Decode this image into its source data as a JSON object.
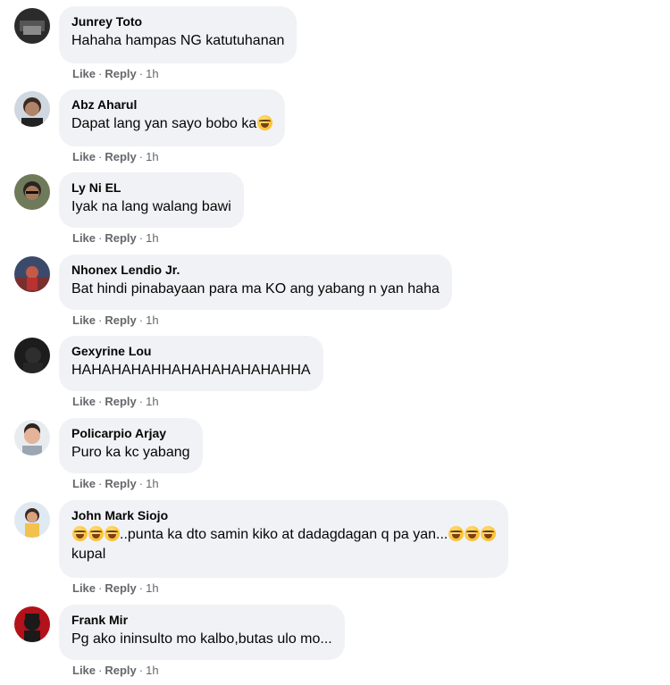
{
  "actions": {
    "like": "Like",
    "reply": "Reply",
    "separator": "·"
  },
  "comments": [
    {
      "author": "Junrey Toto",
      "text": "Hahaha hampas NG katutuhanan",
      "time": "1h"
    },
    {
      "author": "Abz Aharul",
      "text": "Dapat lang yan sayo bobo ka",
      "emoji": [
        "rolling-on-floor-laughing"
      ],
      "time": "1h"
    },
    {
      "author": "Ly Ni EL",
      "text": "Iyak na lang walang bawi",
      "time": "1h"
    },
    {
      "author": "Nhonex Lendio Jr.",
      "text": "Bat hindi pinabayaan para ma KO ang yabang n yan haha",
      "time": "1h"
    },
    {
      "author": "Gexyrine Lou",
      "text": "HAHAHAHAHHAHAHAHAHAHAHHA",
      "time": "1h"
    },
    {
      "author": "Policarpio Arjay",
      "text": "Puro ka kc yabang",
      "time": "1h"
    },
    {
      "author": "John Mark Siojo",
      "text_middle": "..punta ka dto samin kiko at dadagdagan q pa yan...",
      "text_line2": "kupal",
      "emoji": [
        "rolling-on-floor-laughing",
        "rolling-on-floor-laughing",
        "rolling-on-floor-laughing"
      ],
      "time": "1h"
    },
    {
      "author": "Frank Mir",
      "text": "Pg ako ininsulto mo kalbo,butas ulo mo...",
      "time": "1h"
    }
  ],
  "colors": {
    "bubble": "#f0f2f5",
    "text": "#050505",
    "secondary": "#65676b"
  }
}
